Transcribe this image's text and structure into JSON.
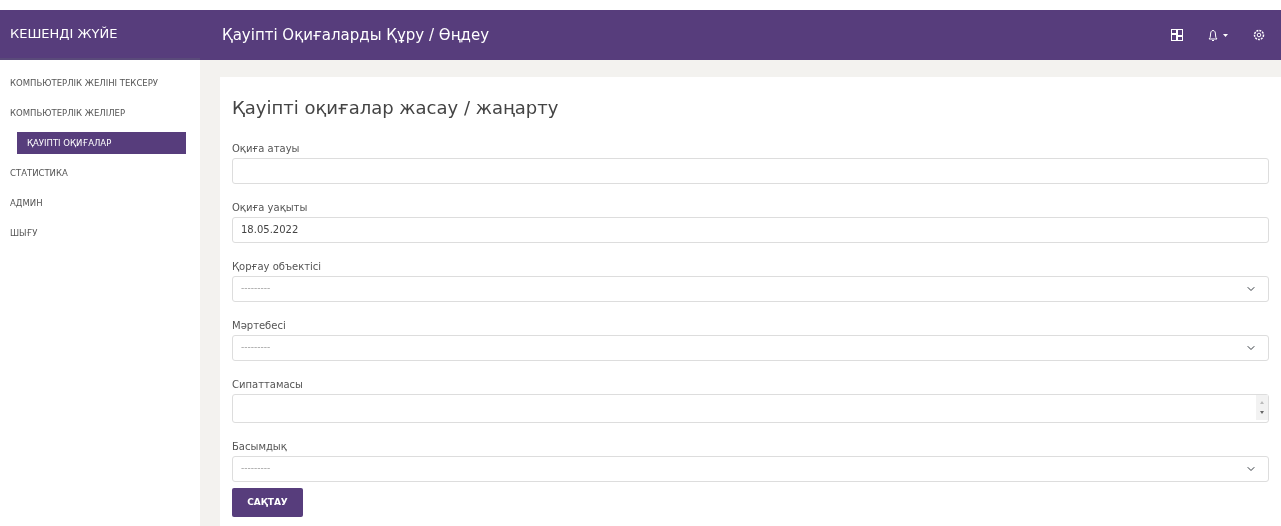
{
  "brand": "КЕШЕНДІ ЖҮЙЕ",
  "header": {
    "title": "Қауіпті Оқиғаларды Құру / Өңдеу"
  },
  "sidebar": {
    "items": [
      {
        "label": "КОМПЬЮТЕРЛІК ЖЕЛІНІ ТЕКСЕРУ",
        "selected": false
      },
      {
        "label": "КОМПЬЮТЕРЛІК ЖЕЛІЛЕР",
        "selected": false
      },
      {
        "label": "ҚАУІПТІ ОҚИҒАЛАР",
        "selected": true
      },
      {
        "label": "СТАТИСТИКА",
        "selected": false
      },
      {
        "label": "АДМИН",
        "selected": false
      },
      {
        "label": "ШЫҒУ",
        "selected": false
      }
    ]
  },
  "form": {
    "title": "Қауіпті оқиғалар жасау / жаңарту",
    "fields": [
      {
        "kind": "text",
        "label": "Оқиға атауы"
      },
      {
        "kind": "text",
        "label": "Оқиға уақыты",
        "value": "18.05.2022"
      },
      {
        "kind": "select",
        "label": "Қорғау объектісі",
        "placeholder": "---------"
      },
      {
        "kind": "select",
        "label": "Мәртебесі",
        "placeholder": "---------"
      },
      {
        "kind": "textarea",
        "label": "Сипаттамасы"
      },
      {
        "kind": "select",
        "label": "Басымдық",
        "placeholder": "---------"
      }
    ],
    "submit": "САҚТАУ"
  }
}
